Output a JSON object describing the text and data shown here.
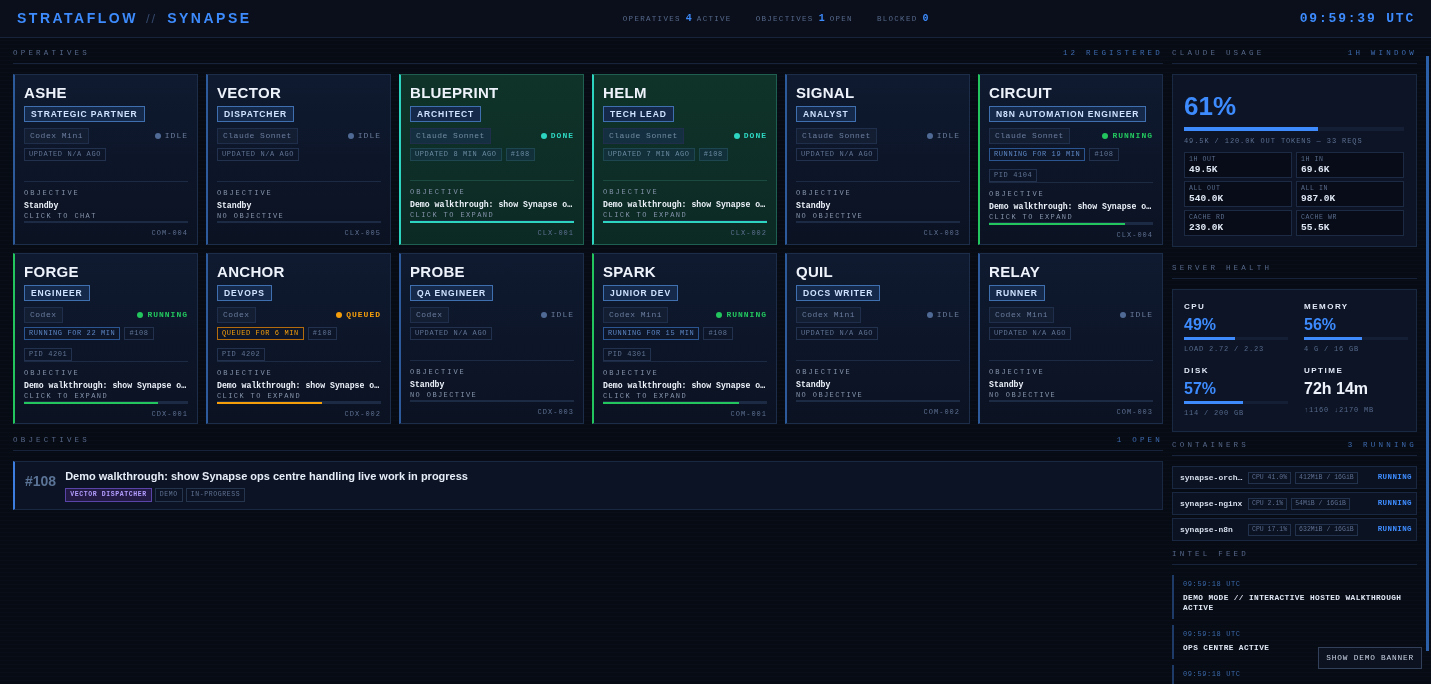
{
  "header": {
    "brand": "STRATAFLOW",
    "separator": "//",
    "product": "SYNAPSE",
    "stats": [
      {
        "label": "OPERATIVES",
        "value": "4",
        "unit": "ACTIVE"
      },
      {
        "label": "OBJECTIVES",
        "value": "1",
        "unit": "OPEN"
      },
      {
        "label": "BLOCKED",
        "value": "0"
      }
    ],
    "clock": "09:59:39 UTC"
  },
  "operatives": {
    "title": "OPERATIVES",
    "meta": "12 REGISTERED",
    "cards": [
      {
        "name": "ASHE",
        "role": "STRATEGIC PARTNER",
        "model": "Codex Mini",
        "status": "IDLE",
        "kind": "idle",
        "chips": [
          {
            "text": "UPDATED N/A AGO",
            "kind": "time"
          }
        ],
        "objective_label": "OBJECTIVE",
        "objective": "Standby",
        "hint": "CLICK TO CHAT",
        "code": "COM-004"
      },
      {
        "name": "VECTOR",
        "role": "DISPATCHER",
        "model": "Claude Sonnet",
        "status": "IDLE",
        "kind": "idle",
        "chips": [
          {
            "text": "UPDATED N/A AGO",
            "kind": "time"
          }
        ],
        "objective_label": "OBJECTIVE",
        "objective": "Standby",
        "hint": "NO OBJECTIVE",
        "code": "CLX-005"
      },
      {
        "name": "BLUEPRINT",
        "role": "ARCHITECT",
        "model": "Claude Sonnet",
        "status": "DONE",
        "kind": "done",
        "chips": [
          {
            "text": "UPDATED 8 MIN AGO",
            "kind": "time"
          },
          {
            "text": "#108",
            "kind": "ref"
          }
        ],
        "objective_label": "OBJECTIVE",
        "objective": "Demo walkthrough: show Synapse o…",
        "hint": "CLICK TO EXPAND",
        "level": 1,
        "code": "CLX-001"
      },
      {
        "name": "HELM",
        "role": "TECH LEAD",
        "model": "Claude Sonnet",
        "status": "DONE",
        "kind": "done",
        "chips": [
          {
            "text": "UPDATED 7 MIN AGO",
            "kind": "time"
          },
          {
            "text": "#108",
            "kind": "ref"
          }
        ],
        "objective_label": "OBJECTIVE",
        "objective": "Demo walkthrough: show Synapse o…",
        "hint": "CLICK TO EXPAND",
        "level": 1,
        "code": "CLX-002"
      },
      {
        "name": "SIGNAL",
        "role": "ANALYST",
        "model": "Claude Sonnet",
        "status": "IDLE",
        "kind": "idle",
        "chips": [
          {
            "text": "UPDATED N/A AGO",
            "kind": "time"
          }
        ],
        "objective_label": "OBJECTIVE",
        "objective": "Standby",
        "hint": "NO OBJECTIVE",
        "code": "CLX-003"
      },
      {
        "name": "CIRCUIT",
        "role": "N8N AUTOMATION ENGINEER",
        "model": "Claude Sonnet",
        "status": "RUNNING",
        "kind": "running",
        "chips": [
          {
            "text": "RUNNING FOR 19 MIN",
            "kind": "time"
          },
          {
            "text": "#108",
            "kind": "ref"
          },
          {
            "text": "PID 4104",
            "kind": "pid"
          }
        ],
        "objective_label": "OBJECTIVE",
        "objective": "Demo walkthrough: show Synapse o…",
        "hint": "CLICK TO EXPAND",
        "level": 0.83,
        "code": "CLX-004"
      },
      {
        "name": "FORGE",
        "role": "ENGINEER",
        "model": "Codex",
        "status": "RUNNING",
        "kind": "running",
        "chips": [
          {
            "text": "RUNNING FOR 22 MIN",
            "kind": "time"
          },
          {
            "text": "#108",
            "kind": "ref"
          },
          {
            "text": "PID 4201",
            "kind": "pid"
          }
        ],
        "objective_label": "OBJECTIVE",
        "objective": "Demo walkthrough: show Synapse o…",
        "hint": "CLICK TO EXPAND",
        "level": 0.82,
        "code": "CDX-001"
      },
      {
        "name": "ANCHOR",
        "role": "DEVOPS",
        "model": "Codex",
        "status": "QUEUED",
        "kind": "queued",
        "chips": [
          {
            "text": "QUEUED FOR 6 MIN",
            "kind": "time"
          },
          {
            "text": "#108",
            "kind": "ref"
          },
          {
            "text": "PID 4202",
            "kind": "pid"
          }
        ],
        "objective_label": "OBJECTIVE",
        "objective": "Demo walkthrough: show Synapse o…",
        "hint": "CLICK TO EXPAND",
        "level": 0.64,
        "code": "CDX-002"
      },
      {
        "name": "PROBE",
        "role": "QA ENGINEER",
        "model": "Codex",
        "status": "IDLE",
        "kind": "idle",
        "chips": [
          {
            "text": "UPDATED N/A AGO",
            "kind": "time"
          }
        ],
        "objective_label": "OBJECTIVE",
        "objective": "Standby",
        "hint": "NO OBJECTIVE",
        "code": "CDX-003"
      },
      {
        "name": "SPARK",
        "role": "JUNIOR DEV",
        "model": "Codex Mini",
        "status": "RUNNING",
        "kind": "running",
        "chips": [
          {
            "text": "RUNNING FOR 15 MIN",
            "kind": "time"
          },
          {
            "text": "#108",
            "kind": "ref"
          },
          {
            "text": "PID 4301",
            "kind": "pid"
          }
        ],
        "objective_label": "OBJECTIVE",
        "objective": "Demo walkthrough: show Synapse o…",
        "hint": "CLICK TO EXPAND",
        "level": 0.83,
        "code": "COM-001"
      },
      {
        "name": "QUIL",
        "role": "DOCS WRITER",
        "model": "Codex Mini",
        "status": "IDLE",
        "kind": "idle",
        "chips": [
          {
            "text": "UPDATED N/A AGO",
            "kind": "time"
          }
        ],
        "objective_label": "OBJECTIVE",
        "objective": "Standby",
        "hint": "NO OBJECTIVE",
        "code": "COM-002"
      },
      {
        "name": "RELAY",
        "role": "RUNNER",
        "model": "Codex Mini",
        "status": "IDLE",
        "kind": "idle",
        "chips": [
          {
            "text": "UPDATED N/A AGO",
            "kind": "time"
          }
        ],
        "objective_label": "OBJECTIVE",
        "objective": "Standby",
        "hint": "NO OBJECTIVE",
        "code": "COM-003"
      }
    ]
  },
  "objectives": {
    "title": "OBJECTIVES",
    "meta": "1 OPEN",
    "items": [
      {
        "ref": "#108",
        "title": "Demo walkthrough: show Synapse ops centre handling live work in progress",
        "tags": [
          {
            "label": "VECTOR DISPATCHER",
            "kind": "assignee"
          },
          {
            "label": "DEMO",
            "kind": "label"
          },
          {
            "label": "IN-PROGRESS",
            "kind": "label"
          }
        ]
      }
    ]
  },
  "usage": {
    "title": "CLAUDE USAGE",
    "meta": "1H WINDOW",
    "percent": "61%",
    "level": 0.61,
    "summary": "49.5K / 120.0K OUT TOKENS — 33 REQS",
    "stats": [
      {
        "label": "1H OUT",
        "value": "49.5K"
      },
      {
        "label": "1H IN",
        "value": "69.6K"
      },
      {
        "label": "ALL OUT",
        "value": "540.0K"
      },
      {
        "label": "ALL IN",
        "value": "987.0K"
      },
      {
        "label": "CACHE RD",
        "value": "230.0K"
      },
      {
        "label": "CACHE WR",
        "value": "55.5K"
      }
    ]
  },
  "server_health": {
    "title": "SERVER HEALTH",
    "metrics": [
      {
        "kind": "gauge",
        "label": "CPU",
        "value": "49%",
        "level": 0.49,
        "detail": "LOAD 2.72 / 2.23"
      },
      {
        "kind": "gauge",
        "label": "MEMORY",
        "value": "56%",
        "level": 0.56,
        "detail": "4 G / 16 GB"
      },
      {
        "kind": "gauge",
        "label": "DISK",
        "value": "57%",
        "level": 0.57,
        "detail": "114 / 200 GB"
      },
      {
        "kind": "text",
        "label": "UPTIME",
        "value": "72h 14m",
        "detail": "↑1160 ↓2170 MB"
      }
    ]
  },
  "containers": {
    "title": "CONTAINERS",
    "meta": "3 RUNNING",
    "items": [
      {
        "name": "synapse-orch…",
        "cpu": "CPU 41.0%",
        "memory": "412MiB / 16GiB",
        "status": "RUNNING"
      },
      {
        "name": "synapse-nginx",
        "cpu": "CPU 2.1%",
        "memory": "54MiB / 16GiB",
        "status": "RUNNING"
      },
      {
        "name": "synapse-n8n",
        "cpu": "CPU 17.1%",
        "memory": "632MiB / 16GiB",
        "status": "RUNNING"
      }
    ]
  },
  "intel_feed": {
    "title": "INTEL FEED",
    "entries": [
      {
        "time": "09:59:18 UTC",
        "message": "DEMO MODE // INTERACTIVE HOSTED WALKTHROUGH ACTIVE"
      },
      {
        "time": "09:59:18 UTC",
        "message": "OPS CENTRE ACTIVE"
      },
      {
        "time": "09:59:18 UTC"
      }
    ]
  },
  "demo_banner_button": "SHOW DEMO BANNER"
}
